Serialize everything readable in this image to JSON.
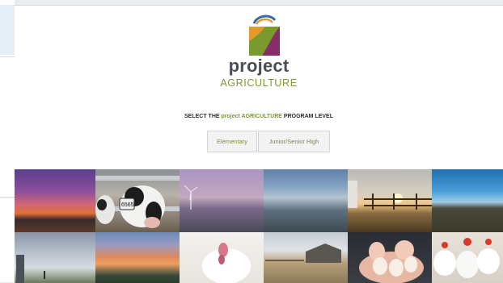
{
  "brand": {
    "line1": "project",
    "line2": "AGRICULTURE"
  },
  "prompt": {
    "prefix": "SELECT THE ",
    "highlight": "project AGRICULTURE",
    "suffix": " PROGRAM LEVEL"
  },
  "levels": [
    {
      "label": "Elementary"
    },
    {
      "label": "Junior/Senior High"
    }
  ],
  "cow_tag_text": "6565",
  "colors": {
    "brand_green": "#7a9a2f",
    "logo_purple": "#8a2d66",
    "logo_orange": "#e39a2c",
    "logo_blue": "#3a6aa6"
  },
  "gallery": [
    {
      "subject": "purple sunset over field"
    },
    {
      "subject": "calves with ear tags"
    },
    {
      "subject": "wind turbine at dusk"
    },
    {
      "subject": "misty valley"
    },
    {
      "subject": "barn at sunset"
    },
    {
      "subject": "blue sky pasture"
    },
    {
      "subject": "farmstead under grey sky"
    },
    {
      "subject": "orange clouds at sunset"
    },
    {
      "subject": "white turkey"
    },
    {
      "subject": "old barn on prairie"
    },
    {
      "subject": "hands holding eggs"
    },
    {
      "subject": "white chickens"
    }
  ]
}
